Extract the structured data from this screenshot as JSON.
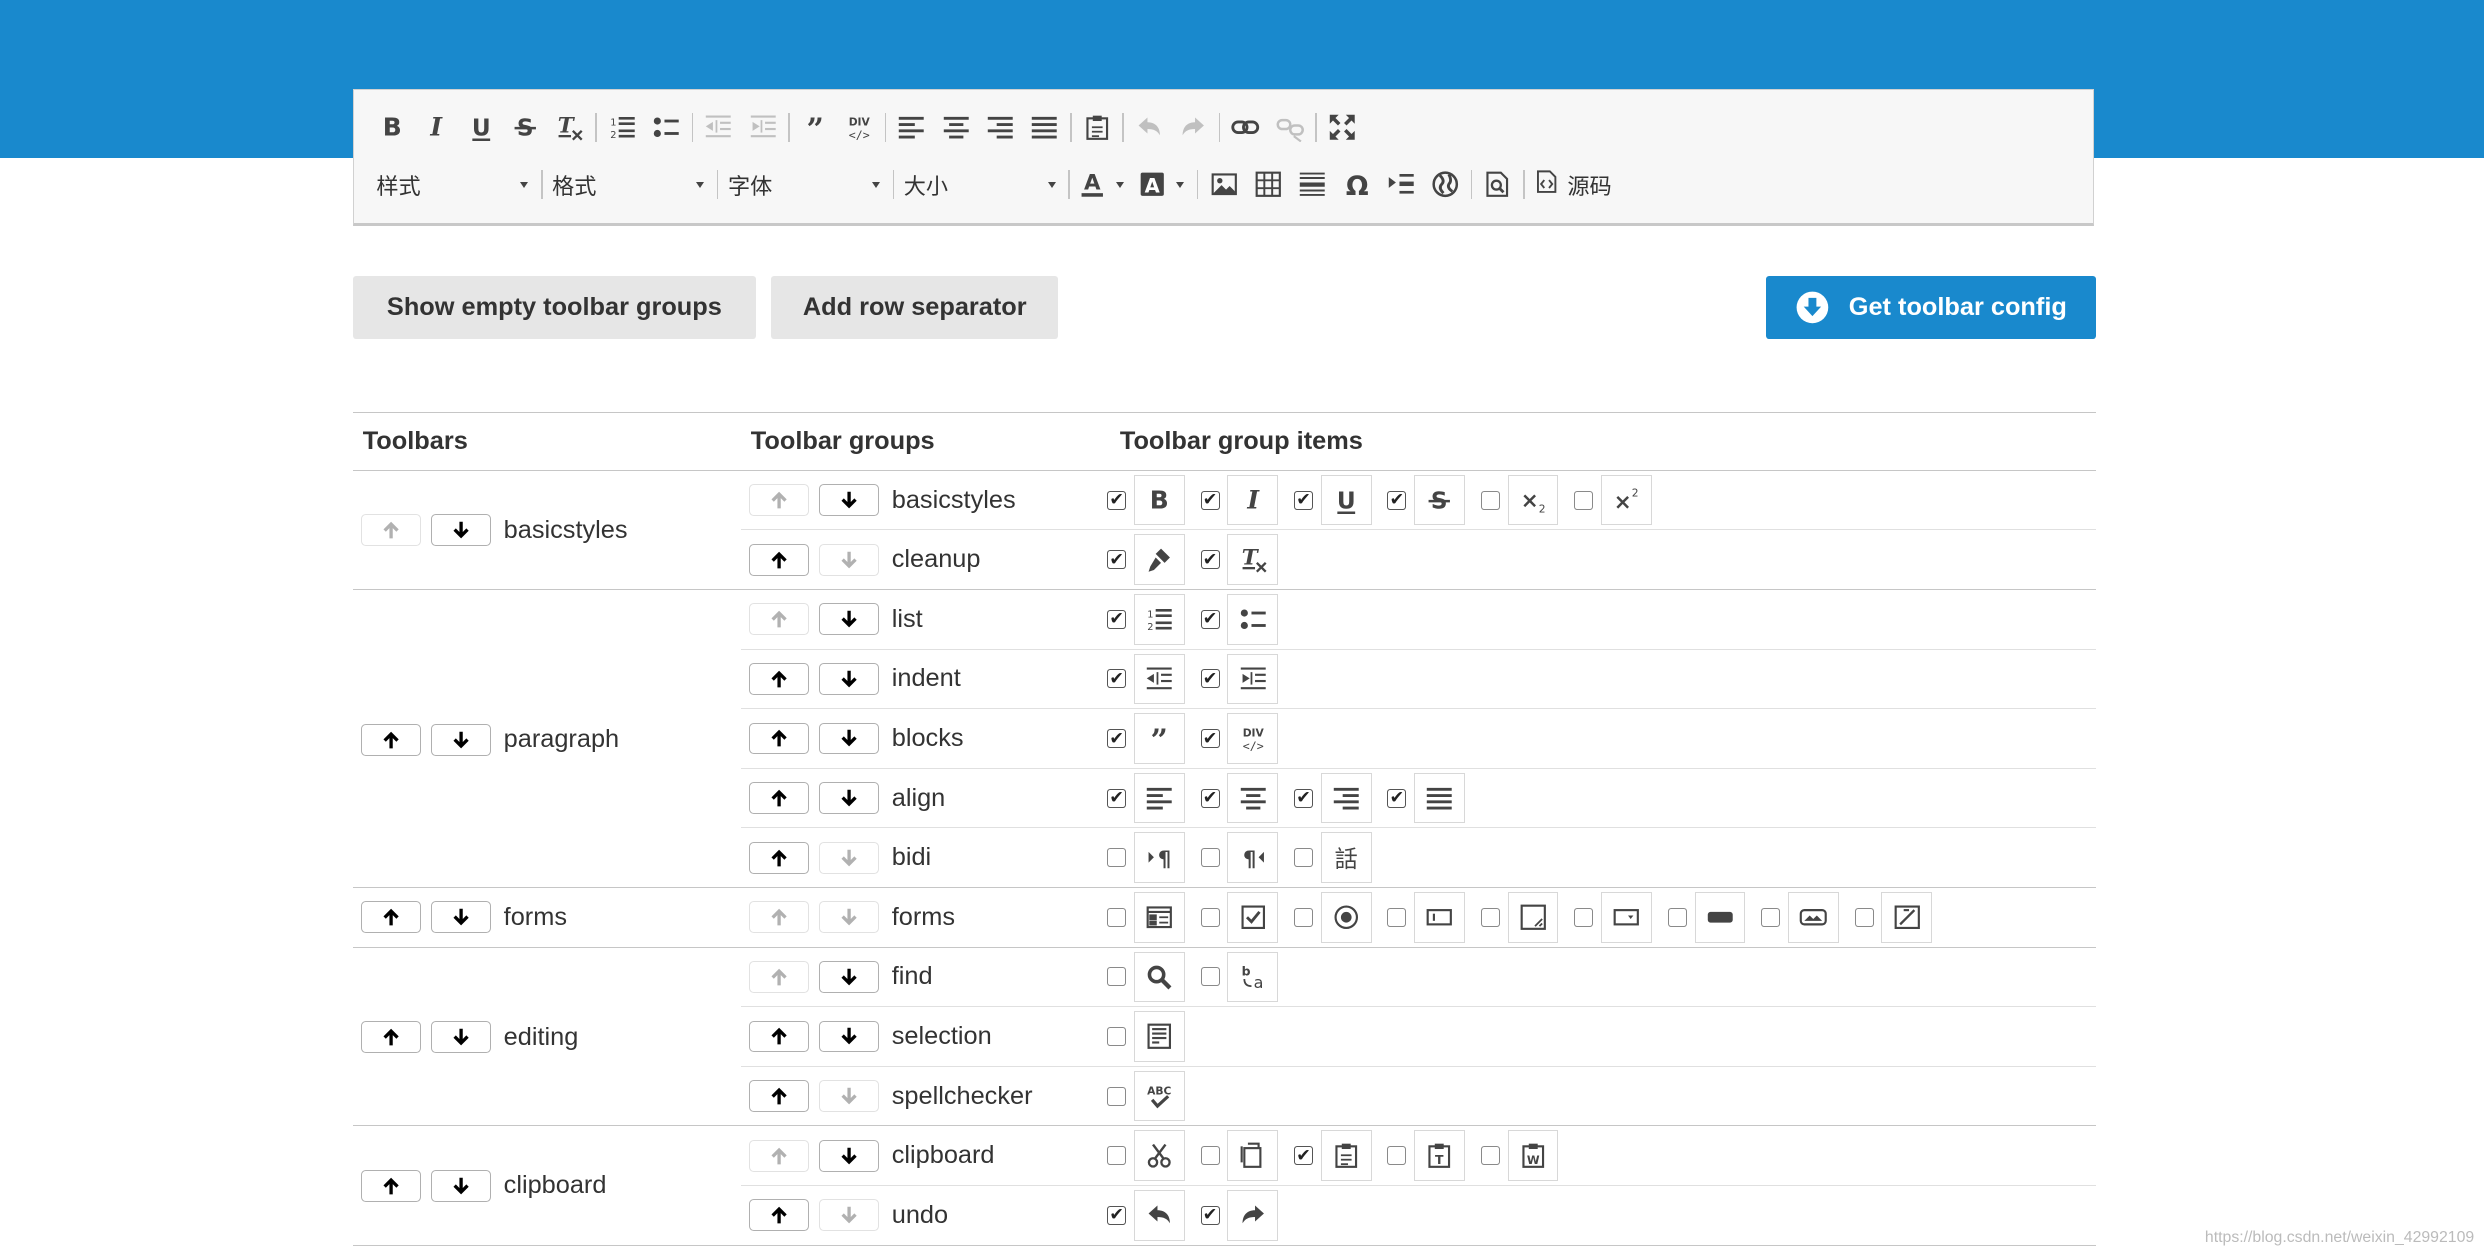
{
  "editor": {
    "combo_style": "样式",
    "combo_format": "格式",
    "combo_font": "字体",
    "combo_size": "大小",
    "source_label": "源码",
    "row1": [
      "bold",
      "italic",
      "underline",
      "strike",
      "removeformat",
      "|",
      "numberedlist",
      "bulletedlist",
      "|",
      "outdent-dis",
      "indent-dis",
      "|",
      "blockquote",
      "creatediv",
      "|",
      "justifyleft",
      "justifycenter",
      "justifyright",
      "justifyblock",
      "|",
      "paste",
      "|",
      "undo-dis",
      "redo-dis",
      "|",
      "link",
      "unlink-dis",
      "|",
      "maximize"
    ]
  },
  "actions": {
    "show_empty": "Show empty toolbar groups",
    "add_row": "Add row separator",
    "get_config": "Get toolbar config"
  },
  "table": {
    "headers": [
      "Toolbars",
      "Toolbar groups",
      "Toolbar group items"
    ],
    "toolbars": [
      {
        "name": "basicstyles",
        "up": false,
        "down": true,
        "subgroups": [
          {
            "name": "basicstyles",
            "up": false,
            "down": true,
            "items": [
              {
                "icon": "bold",
                "checked": true
              },
              {
                "icon": "italic",
                "checked": true
              },
              {
                "icon": "underline",
                "checked": true
              },
              {
                "icon": "strike",
                "checked": true
              },
              {
                "icon": "subscript",
                "checked": false
              },
              {
                "icon": "superscript",
                "checked": false
              }
            ]
          },
          {
            "name": "cleanup",
            "up": true,
            "down": false,
            "items": [
              {
                "icon": "copyformatting",
                "checked": true
              },
              {
                "icon": "removeformat",
                "checked": true
              }
            ]
          }
        ]
      },
      {
        "name": "paragraph",
        "up": true,
        "down": true,
        "subgroups": [
          {
            "name": "list",
            "up": false,
            "down": true,
            "items": [
              {
                "icon": "numberedlist",
                "checked": true
              },
              {
                "icon": "bulletedlist",
                "checked": true
              }
            ]
          },
          {
            "name": "indent",
            "up": true,
            "down": true,
            "items": [
              {
                "icon": "outdent",
                "checked": true
              },
              {
                "icon": "indent",
                "checked": true
              }
            ]
          },
          {
            "name": "blocks",
            "up": true,
            "down": true,
            "items": [
              {
                "icon": "blockquote",
                "checked": true
              },
              {
                "icon": "creatediv",
                "checked": true
              }
            ]
          },
          {
            "name": "align",
            "up": true,
            "down": true,
            "items": [
              {
                "icon": "justifyleft",
                "checked": true
              },
              {
                "icon": "justifycenter",
                "checked": true
              },
              {
                "icon": "justifyright",
                "checked": true
              },
              {
                "icon": "justifyblock",
                "checked": true
              }
            ]
          },
          {
            "name": "bidi",
            "up": true,
            "down": false,
            "items": [
              {
                "icon": "bidiltr",
                "checked": false
              },
              {
                "icon": "bidirtl",
                "checked": false
              },
              {
                "icon": "language",
                "checked": false
              }
            ]
          }
        ]
      },
      {
        "name": "forms",
        "up": true,
        "down": true,
        "subgroups": [
          {
            "name": "forms",
            "up": false,
            "down": false,
            "items": [
              {
                "icon": "form",
                "checked": false
              },
              {
                "icon": "checkbox",
                "checked": false
              },
              {
                "icon": "radio",
                "checked": false
              },
              {
                "icon": "textfield",
                "checked": false
              },
              {
                "icon": "textarea",
                "checked": false
              },
              {
                "icon": "select",
                "checked": false
              },
              {
                "icon": "button",
                "checked": false
              },
              {
                "icon": "imagebutton",
                "checked": false
              },
              {
                "icon": "hiddenfield",
                "checked": false
              }
            ]
          }
        ]
      },
      {
        "name": "editing",
        "up": true,
        "down": true,
        "subgroups": [
          {
            "name": "find",
            "up": false,
            "down": true,
            "items": [
              {
                "icon": "find",
                "checked": false
              },
              {
                "icon": "replace",
                "checked": false
              }
            ]
          },
          {
            "name": "selection",
            "up": true,
            "down": true,
            "items": [
              {
                "icon": "selectall",
                "checked": false
              }
            ]
          },
          {
            "name": "spellchecker",
            "up": true,
            "down": false,
            "items": [
              {
                "icon": "spellchecker",
                "checked": false
              }
            ]
          }
        ]
      },
      {
        "name": "clipboard",
        "up": true,
        "down": true,
        "subgroups": [
          {
            "name": "clipboard",
            "up": false,
            "down": true,
            "items": [
              {
                "icon": "cut",
                "checked": false
              },
              {
                "icon": "copy",
                "checked": false
              },
              {
                "icon": "paste",
                "checked": true
              },
              {
                "icon": "pastetext",
                "checked": false
              },
              {
                "icon": "pastefromword",
                "checked": false
              }
            ]
          },
          {
            "name": "undo",
            "up": true,
            "down": false,
            "items": [
              {
                "icon": "undo",
                "checked": true
              },
              {
                "icon": "redo",
                "checked": true
              }
            ]
          }
        ]
      }
    ]
  },
  "watermark": "https://blog.csdn.net/weixin_42992109"
}
